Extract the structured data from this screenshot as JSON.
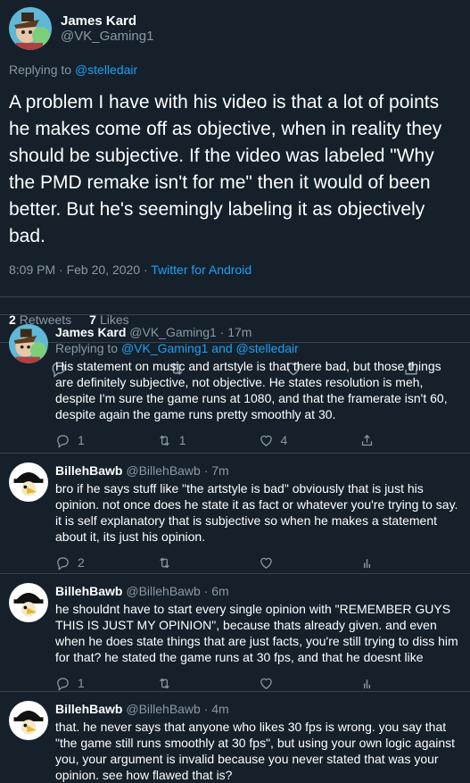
{
  "colors": {
    "background": "#15202b",
    "accent": "#1da1f2",
    "muted": "#8899a6",
    "divider": "#38444d"
  },
  "tweet": {
    "display_name": "James Kard",
    "handle": "@VK_Gaming1",
    "replying_prefix": "Replying to ",
    "replying_to": "@stelledair",
    "text": "A problem I have with his video is that a lot of points he makes come off as objective, when in reality they should be subjective. If the video was labeled \"Why the PMD remake isn't for me\" then it would of been better. But he's seemingly labeling it as objectively bad.",
    "time": "8:09 PM · Feb 20, 2020 · ",
    "source": "Twitter for Android",
    "retweets_count": "2",
    "retweets_label": "Retweets",
    "likes_count": "7",
    "likes_label": "Likes"
  },
  "replies": [
    {
      "display_name": "James Kard",
      "handle_time": "@VK_Gaming1 · 17m",
      "replying_prefix": "Replying to ",
      "replying_to": "@VK_Gaming1 and @stelledair",
      "text": "His statement on music and artstyle is that there bad, but those things are definitely subjective, not objective. He states resolution is meh, despite I'm sure the game runs at 1080, and that the framerate isn't 60, despite again the game runs pretty smoothly at 30.",
      "reply_count": "1",
      "retweet_count": "1",
      "like_count": "4",
      "icons": [
        "reply-icon",
        "retweet-icon",
        "like-icon",
        "share-icon"
      ]
    },
    {
      "display_name": "BillehBawb",
      "handle_time": "@BillehBawb · 7m",
      "text": "bro if he says stuff like \"the artstyle is bad\" obviously that is just his opinion. not once does he state it as fact or whatever you're trying to say. it is self explanatory that is subjective so when he makes a statement about it, its just his opinion.",
      "reply_count": "2",
      "retweet_count": "",
      "like_count": "",
      "icons": [
        "reply-icon",
        "retweet-icon",
        "like-icon",
        "analytics-icon"
      ]
    },
    {
      "display_name": "BillehBawb",
      "handle_time": "@BillehBawb · 6m",
      "text": "he shouldnt have to start every single opinion with \"REMEMBER GUYS THIS IS JUST MY OPINION\", because thats already given. and even when he does state things that are just facts, you're still trying to diss him for that? he stated the game runs at 30 fps, and that he doesnt like",
      "reply_count": "1",
      "retweet_count": "",
      "like_count": "",
      "icons": [
        "reply-icon",
        "retweet-icon",
        "like-icon",
        "analytics-icon"
      ]
    },
    {
      "display_name": "BillehBawb",
      "handle_time": "@BillehBawb · 4m",
      "text": "that. he never says that anyone who likes 30 fps is wrong. you say that \"the game still runs smoothly at 30 fps\", but using your own logic against you, your argument is invalid because you never stated that was your opinion. see how flawed that is?"
    }
  ]
}
